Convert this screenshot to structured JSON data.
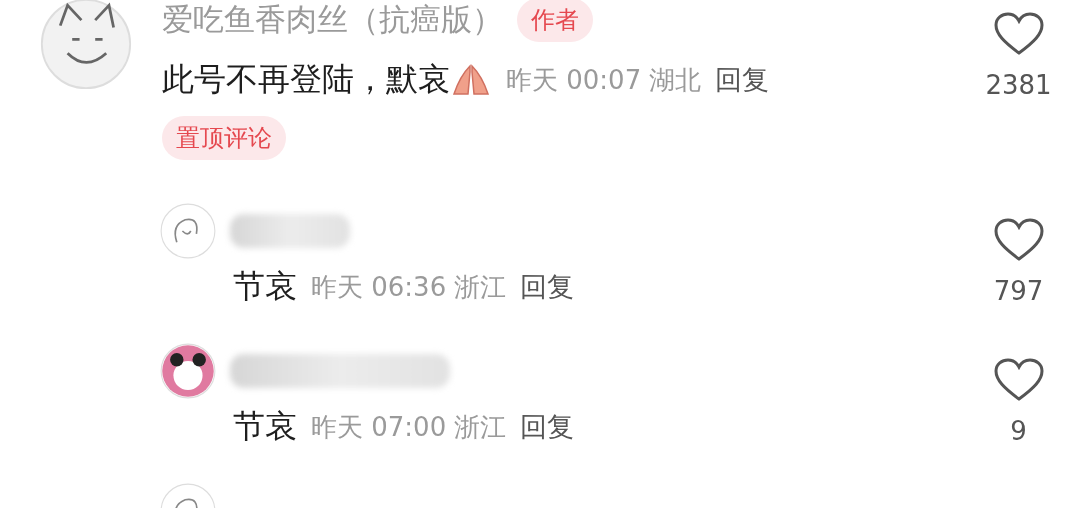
{
  "top_comment": {
    "author": "爱吃鱼香肉丝（抗癌版）",
    "author_badge": "作者",
    "text": "此号不再登陆，默哀",
    "time": "昨天 00:07",
    "location": "湖北",
    "reply": "回复",
    "pinned_badge": "置顶评论",
    "likes": "2381"
  },
  "replies": [
    {
      "text": "节哀",
      "time": "昨天 06:36",
      "location": "浙江",
      "reply": "回复",
      "likes": "797"
    },
    {
      "text": "节哀",
      "time": "昨天 07:00",
      "location": "浙江",
      "reply": "回复",
      "likes": "9"
    }
  ]
}
